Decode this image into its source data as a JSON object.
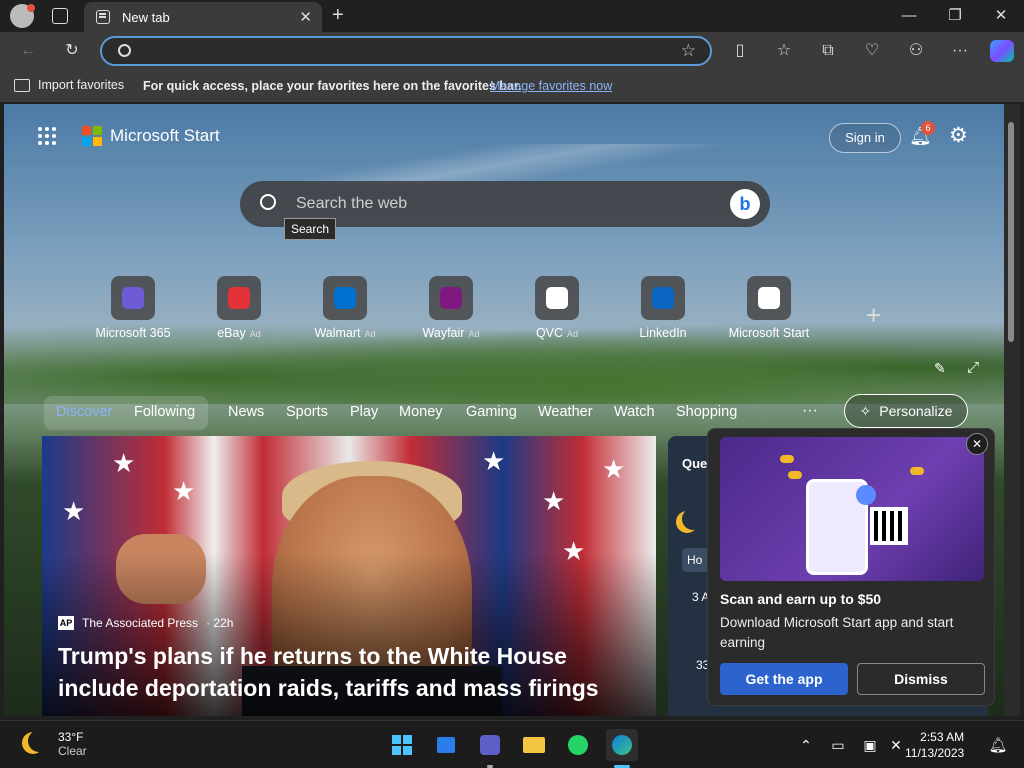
{
  "browser": {
    "tab_title": "New tab",
    "address_placeholder": "",
    "favorites_bar": {
      "import_label": "Import favorites",
      "message": "For quick access, place your favorites here on the favorites bar.",
      "manage_link": "Manage favorites now"
    }
  },
  "page": {
    "brand": "Microsoft Start",
    "sign_in": "Sign in",
    "notification_count": "6",
    "search_placeholder": "Search the web",
    "tooltip": "Search",
    "quick_links": [
      {
        "label": "Microsoft 365",
        "ad": "",
        "icon": "microsoft-365-icon"
      },
      {
        "label": "eBay",
        "ad": "Ad",
        "icon": "ebay-icon"
      },
      {
        "label": "Walmart",
        "ad": "Ad",
        "icon": "walmart-icon"
      },
      {
        "label": "Wayfair",
        "ad": "Ad",
        "icon": "wayfair-icon"
      },
      {
        "label": "QVC",
        "ad": "Ad",
        "icon": "qvc-icon"
      },
      {
        "label": "LinkedIn",
        "ad": "",
        "icon": "linkedin-icon"
      },
      {
        "label": "Microsoft Start",
        "ad": "",
        "icon": "microsoft-start-icon"
      }
    ],
    "nav": [
      "Discover",
      "Following",
      "News",
      "Sports",
      "Play",
      "Money",
      "Gaming",
      "Weather",
      "Watch",
      "Shopping"
    ],
    "personalize": "Personalize",
    "hero": {
      "source": "The Associated Press",
      "age": "· 22h",
      "headline": "Trump's plans if he returns to the White House include deportation raids, tariffs and mass firings"
    },
    "side_title": "Que",
    "side_hint1": "Ho",
    "side_hint2": "3 A",
    "side_hint3": "33",
    "popup": {
      "title": "Scan and earn up to $50",
      "description": "Download Microsoft Start app and start earning",
      "primary": "Get the app",
      "secondary": "Dismiss"
    }
  },
  "taskbar": {
    "temp": "33°F",
    "condition": "Clear",
    "time": "2:53 AM",
    "date": "11/13/2023"
  },
  "colors": {
    "accent": "#2c63cc",
    "link": "#8ab4f8",
    "badge": "#e0543a"
  }
}
